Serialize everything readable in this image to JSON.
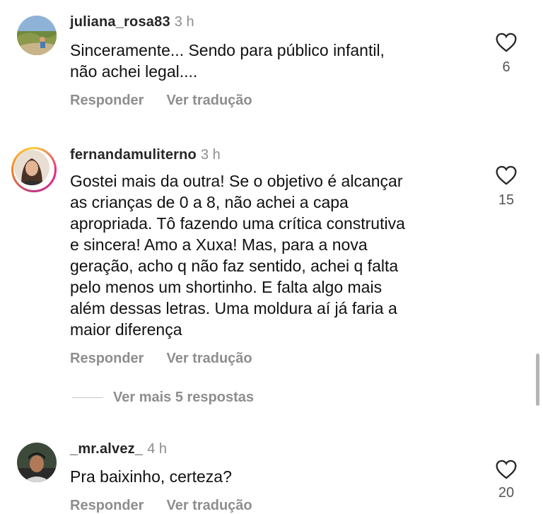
{
  "comments": [
    {
      "username": "juliana_rosa83",
      "time": "3 h",
      "text": "Sinceramente... Sendo para público infantil,\nnão achei legal....",
      "likes": "6",
      "reply_label": "Responder",
      "translate_label": "Ver tradução"
    },
    {
      "username": "fernandamuliterno",
      "time": "3 h",
      "text": "Gostei mais da outra! Se o objetivo é alcançar\nas crianças de 0 a 8, não achei a capa\napropriada. Tô fazendo uma crítica construtiva\ne sincera! Amo a Xuxa! Mas, para a nova\ngeração, acho q não faz sentido, achei q falta\npelo menos um shortinho. E falta algo mais\nalém dessas letras. Uma moldura aí já faria a\nmaior diferença",
      "likes": "15",
      "reply_label": "Responder",
      "translate_label": "Ver tradução",
      "more_replies": "Ver mais 5 respostas"
    },
    {
      "username": "_mr.alvez_",
      "time": "4 h",
      "text": "Pra baixinho, certeza?",
      "likes": "20",
      "reply_label": "Responder",
      "translate_label": "Ver tradução"
    }
  ],
  "icons": {
    "like": "heart-outline-icon"
  },
  "colors": {
    "muted": "#8e8e8e",
    "username": "#262626"
  }
}
